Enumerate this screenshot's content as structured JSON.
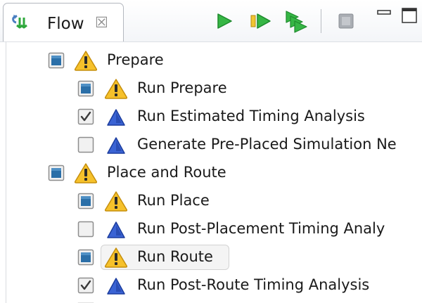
{
  "view": {
    "title": "Flow",
    "close_glyph": "☒",
    "tab_icon": "flow-arrows-icon"
  },
  "toolbar": {
    "buttons": [
      {
        "name": "run-button",
        "icon": "play-icon"
      },
      {
        "name": "run-step-button",
        "icon": "step-forward-icon"
      },
      {
        "name": "run-all-button",
        "icon": "fast-forward-icon"
      },
      {
        "name": "stop-button",
        "icon": "stop-icon"
      },
      {
        "name": "minimize-button",
        "icon": "minimize-icon"
      },
      {
        "name": "maximize-button",
        "icon": "maximize-icon"
      }
    ]
  },
  "colors": {
    "play_green": "#2ea83c",
    "warning_yellow": "#f6c12b",
    "info_blue": "#2a54c8",
    "checkbox_fill": "#2b6fa8"
  },
  "tree": {
    "items": [
      {
        "label": "Prepare",
        "depth": 0,
        "check": "partial",
        "status": "warning"
      },
      {
        "label": "Run Prepare",
        "depth": 1,
        "check": "partial",
        "status": "warning"
      },
      {
        "label": "Run Estimated Timing Analysis",
        "depth": 1,
        "check": "checked",
        "status": "info"
      },
      {
        "label": "Generate Pre-Placed Simulation Ne",
        "depth": 1,
        "check": "unchecked",
        "status": "info"
      },
      {
        "label": "Place and Route",
        "depth": 0,
        "check": "partial",
        "status": "warning"
      },
      {
        "label": "Run Place",
        "depth": 1,
        "check": "partial",
        "status": "warning"
      },
      {
        "label": "Run Post-Placement Timing Analy",
        "depth": 1,
        "check": "unchecked",
        "status": "info"
      },
      {
        "label": "Run Route",
        "depth": 1,
        "check": "partial",
        "status": "warning",
        "selected": true
      },
      {
        "label": "Run Post-Route Timing Analysis",
        "depth": 1,
        "check": "checked",
        "status": "info"
      }
    ]
  }
}
